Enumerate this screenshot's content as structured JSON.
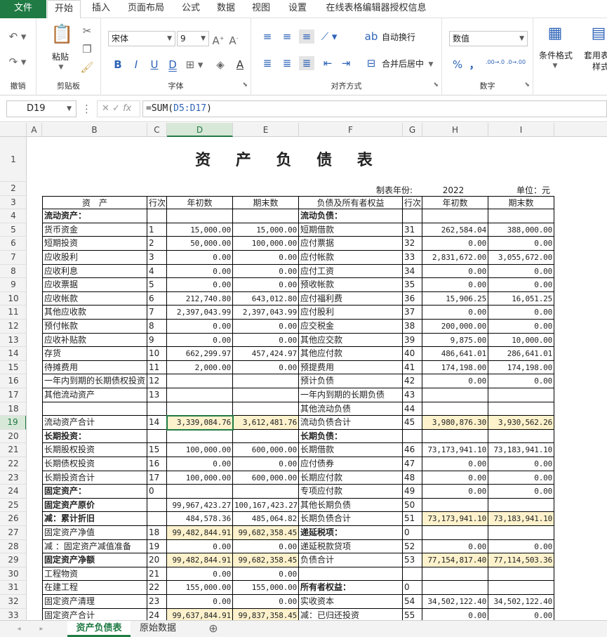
{
  "menu": {
    "tabs": [
      "文件",
      "开始",
      "插入",
      "页面布局",
      "公式",
      "数据",
      "视图",
      "设置",
      "在线表格编辑器授权信息"
    ]
  },
  "ribbon": {
    "undo_group": "撤销",
    "clipboard": {
      "paste": "粘贴",
      "group": "剪贴板"
    },
    "font": {
      "name": "宋体",
      "size": "9",
      "group": "字体"
    },
    "align": {
      "wrap": "自动换行",
      "merge": "合并后居中",
      "group": "对齐方式"
    },
    "number": {
      "format": "数值",
      "group": "数字",
      "percent": "%",
      "comma": "，",
      "inc": ".00→.0",
      "dec": ".0→.00"
    },
    "styles": {
      "cond": "条件格式",
      "table": "套用表",
      "table2": "样式"
    }
  },
  "formula_bar": {
    "cell": "D19",
    "fx": "fx",
    "formula_prefix": "=SUM(",
    "formula_ref": "D5:D17",
    "formula_suffix": ")"
  },
  "columns": [
    "A",
    "B",
    "C",
    "D",
    "E",
    "F",
    "G",
    "H",
    "I"
  ],
  "rows": [
    "1",
    "2",
    "3",
    "4",
    "5",
    "6",
    "7",
    "8",
    "9",
    "10",
    "11",
    "12",
    "13",
    "14",
    "15",
    "16",
    "17",
    "18",
    "19",
    "20",
    "21",
    "22",
    "23",
    "24",
    "25",
    "26",
    "27",
    "28",
    "29",
    "30",
    "31",
    "32",
    "33"
  ],
  "sheet": {
    "title": "资 产 负 债 表",
    "year_label": "制表年份:",
    "year": "2022",
    "unit": "单位：元",
    "headers": [
      "资　产",
      "行次",
      "年初数",
      "期末数",
      "负债及所有者权益",
      "行次",
      "年初数",
      "期末数"
    ],
    "rows": [
      [
        "流动资产：",
        "",
        "",
        "",
        "流动负债：",
        "",
        "",
        ""
      ],
      [
        "  货币资金",
        "1",
        "15,000.00",
        "15,000.00",
        "  短期借款",
        "31",
        "262,584.04",
        "388,000.00"
      ],
      [
        "  短期投资",
        "2",
        "50,000.00",
        "100,000.00",
        "  应付票据",
        "32",
        "0.00",
        "0.00"
      ],
      [
        "  应收股利",
        "3",
        "0.00",
        "0.00",
        "  应付帐款",
        "33",
        "2,831,672.00",
        "3,055,672.00"
      ],
      [
        "  应收利息",
        "4",
        "0.00",
        "0.00",
        "  应付工资",
        "34",
        "0.00",
        "0.00"
      ],
      [
        "  应收票据",
        "5",
        "0.00",
        "0.00",
        "  预收帐款",
        "35",
        "0.00",
        "0.00"
      ],
      [
        "  应收帐款",
        "6",
        "212,740.80",
        "643,012.80",
        "  应付福利费",
        "36",
        "15,906.25",
        "16,051.25"
      ],
      [
        "  其他应收款",
        "7",
        "2,397,043.99",
        "2,397,043.99",
        "  应付股利",
        "37",
        "0.00",
        "0.00"
      ],
      [
        "  预付帐款",
        "8",
        "0.00",
        "0.00",
        "  应交税金",
        "38",
        "200,000.00",
        "0.00"
      ],
      [
        "  应收补贴款",
        "9",
        "0.00",
        "0.00",
        "  其他应交款",
        "39",
        "9,875.00",
        "10,000.00"
      ],
      [
        "  存货",
        "10",
        "662,299.97",
        "457,424.97",
        "  其他应付款",
        "40",
        "486,641.01",
        "286,641.01"
      ],
      [
        "  待摊费用",
        "11",
        "2,000.00",
        "0.00",
        "  预提费用",
        "41",
        "174,198.00",
        "174,198.00"
      ],
      [
        "一年内到期的长期债权投资",
        "12",
        "",
        "",
        "  预计负债",
        "42",
        "0.00",
        "0.00"
      ],
      [
        "  其他流动资产",
        "13",
        "",
        "",
        "一年内到期的长期负债",
        "43",
        "",
        ""
      ],
      [
        "",
        "",
        "",
        "",
        "  其他流动负债",
        "44",
        "",
        ""
      ],
      [
        "  流动资产合计",
        "14",
        "3,339,084.76",
        "3,612,481.76",
        "  流动负债合计",
        "45",
        "3,980,876.30",
        "3,930,562.26"
      ],
      [
        "长期投资：",
        "",
        "",
        "",
        "长期负债：",
        "",
        "",
        ""
      ],
      [
        "  长期股权投资",
        "15",
        "100,000.00",
        "600,000.00",
        "  长期借款",
        "46",
        "73,173,941.10",
        "73,183,941.10"
      ],
      [
        "  长期债权投资",
        "16",
        "0.00",
        "0.00",
        "  应付债券",
        "47",
        "0.00",
        "0.00"
      ],
      [
        "  长期投资合计",
        "17",
        "100,000.00",
        "600,000.00",
        "  长期应付款",
        "48",
        "0.00",
        "0.00"
      ],
      [
        "固定资产：",
        "0",
        "",
        "",
        "  专项应付款",
        "49",
        "0.00",
        "0.00"
      ],
      [
        "固定资产原价",
        "",
        "99,967,423.27",
        "100,167,423.27",
        "  其他长期负债",
        "50",
        "",
        ""
      ],
      [
        "  减：累计折旧",
        "",
        "484,578.36",
        "485,064.82",
        "  长期负债合计",
        "51",
        "73,173,941.10",
        "73,183,941.10"
      ],
      [
        "  固定资产净值",
        "18",
        "99,482,844.91",
        "99,682,358.45",
        "递延税项：",
        "0",
        "",
        ""
      ],
      [
        "  减 ：固定资产减值准备",
        "19",
        "0.00",
        "0.00",
        "  递延税款贷项",
        "52",
        "0.00",
        "0.00"
      ],
      [
        "固定资产净额",
        "20",
        "99,482,844.91",
        "99,682,358.45",
        "  负债合计",
        "53",
        "77,154,817.40",
        "77,114,503.36"
      ],
      [
        "  工程物资",
        "21",
        "0.00",
        "0.00",
        "",
        "",
        "",
        ""
      ],
      [
        "  在建工程",
        "22",
        "155,000.00",
        "155,000.00",
        "所有者权益：",
        "0",
        "",
        ""
      ],
      [
        "  固定资产清理",
        "23",
        "0.00",
        "0.00",
        "  实收资本",
        "54",
        "34,502,122.40",
        "34,502,122.40"
      ],
      [
        "  固定资产合计",
        "24",
        "99,637,844.91",
        "99,837,358.45",
        "  减：已归还投资",
        "55",
        "0.00",
        "0.00"
      ]
    ]
  },
  "tabs": {
    "active": "资产负债表",
    "other": "原始数据",
    "add": "⊕"
  }
}
